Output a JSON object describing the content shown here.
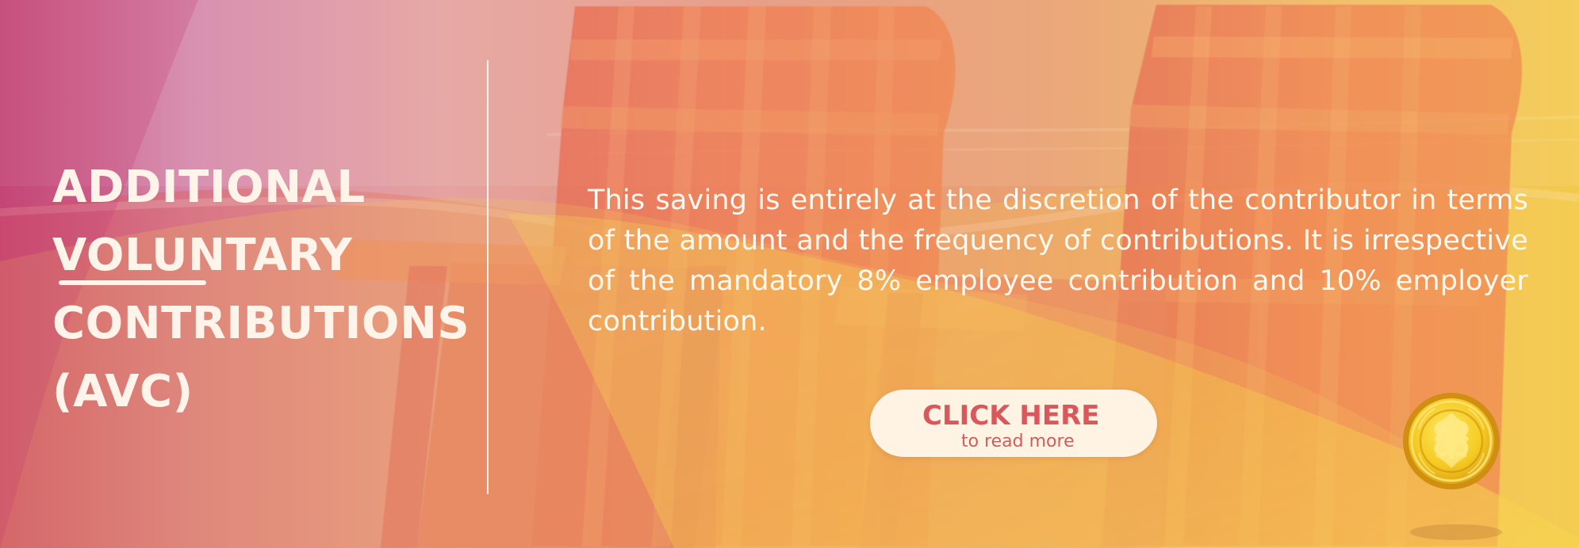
{
  "banner": {
    "title_lines": [
      "ADDITIONAL",
      "VOLUNTARY",
      "CONTRIBUTIONS",
      "(AVC)"
    ],
    "description": "This saving is entirely at the discretion of the contributor in terms of the amount and the frequency of contributions.  It is irrespective of the mandatory 8% employee contribution and 10%   employer contribution.",
    "cta": {
      "title": "CLICK HERE",
      "subtitle": "to read more"
    },
    "colors": {
      "title_text": "#fff4ea",
      "cta_background": "#fff4e4",
      "cta_text": "#d9585b",
      "accent_gold": "#f0c54c",
      "accent_pink": "#c84a79"
    },
    "icons": {
      "hero_image": "beach-chairs-image",
      "badge": "gold-medal-icon"
    }
  }
}
